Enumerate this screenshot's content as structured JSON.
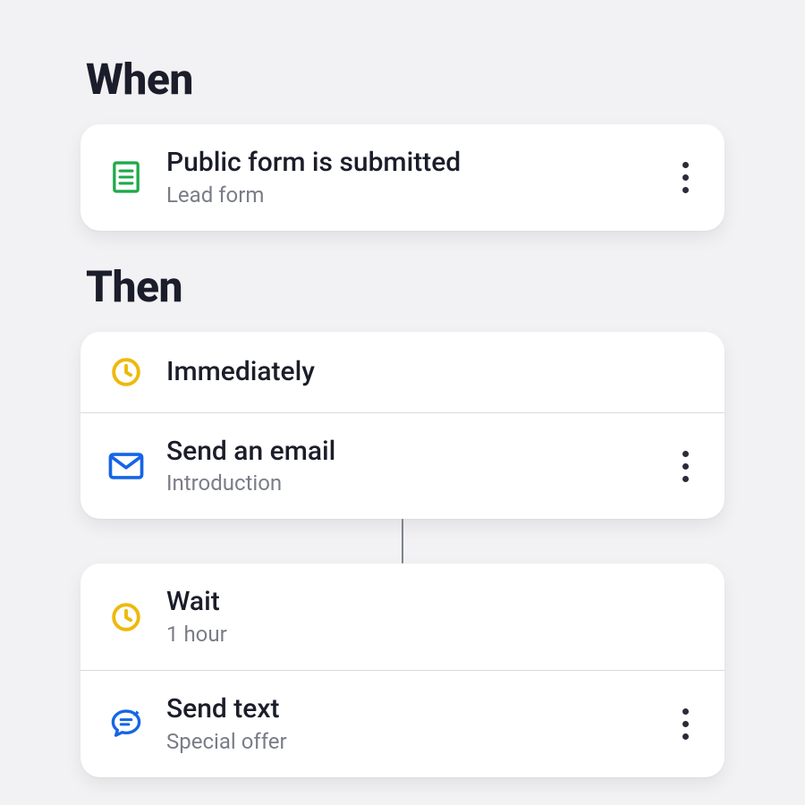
{
  "when": {
    "heading": "When",
    "trigger": {
      "title": "Public form is submitted",
      "subtitle": "Lead form"
    }
  },
  "then": {
    "heading": "Then",
    "group1": {
      "immediate": {
        "title": "Immediately"
      },
      "email": {
        "title": "Send an email",
        "subtitle": "Introduction"
      }
    },
    "group2": {
      "wait": {
        "title": "Wait",
        "subtitle": "1 hour"
      },
      "text": {
        "title": "Send text",
        "subtitle": "Special offer"
      }
    }
  }
}
